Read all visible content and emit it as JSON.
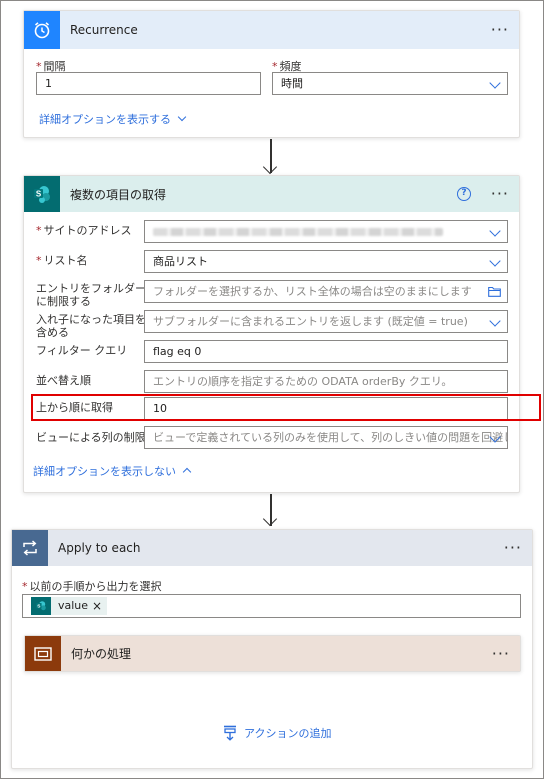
{
  "recurrence": {
    "title": "Recurrence",
    "more": "···",
    "interval_label": "間隔",
    "interval_value": "1",
    "frequency_label": "頻度",
    "frequency_value": "時間",
    "show_advanced": "詳細オプションを表示する",
    "icon": "alarm-clock-icon"
  },
  "get_items": {
    "title": "複数の項目の取得",
    "more": "···",
    "help": "?",
    "icon": "sharepoint-icon",
    "site_label": "サイトのアドレス",
    "list_label": "リスト名",
    "list_value": "商品リスト",
    "folder_label_1": "エントリをフォルダー",
    "folder_label_2": "に制限する",
    "folder_placeholder": "フォルダーを選択するか、リスト全体の場合は空のままにします",
    "nested_label_1": "入れ子になった項目を",
    "nested_label_2": "含める",
    "nested_placeholder": "サブフォルダーに含まれるエントリを返します (既定値 = true)",
    "filter_label": "フィルター クエリ",
    "filter_value": "flag eq 0",
    "order_label": "並べ替え順",
    "order_placeholder": "エントリの順序を指定するための ODATA orderBy クエリ。",
    "top_label": "上から順に取得",
    "top_value": "10",
    "view_label": "ビューによる列の制限",
    "view_placeholder": "ビューで定義されている列のみを使用して、列のしきい値の問題を回避し",
    "hide_advanced": "詳細オプションを表示しない"
  },
  "apply_each": {
    "title": "Apply to each",
    "more": "···",
    "icon": "loop-icon",
    "select_label": "以前の手順から出力を選択",
    "token_label": "value",
    "token_close": "×",
    "inner_title": "何かの処理",
    "inner_more": "···",
    "inner_icon": "scope-icon",
    "add_action": "アクションの追加"
  },
  "colors": {
    "recurrence_header": "#e3edf9",
    "recurrence_icon": "#1f85ff",
    "sharepoint_header": "#dbeeed",
    "sharepoint_icon": "#036c70",
    "loop_header": "#e3e7ee",
    "loop_icon": "#486991",
    "scope_header": "#ede0d8",
    "scope_icon": "#8c3a0c",
    "highlight": "#e00000",
    "link": "#2f6fdc"
  }
}
